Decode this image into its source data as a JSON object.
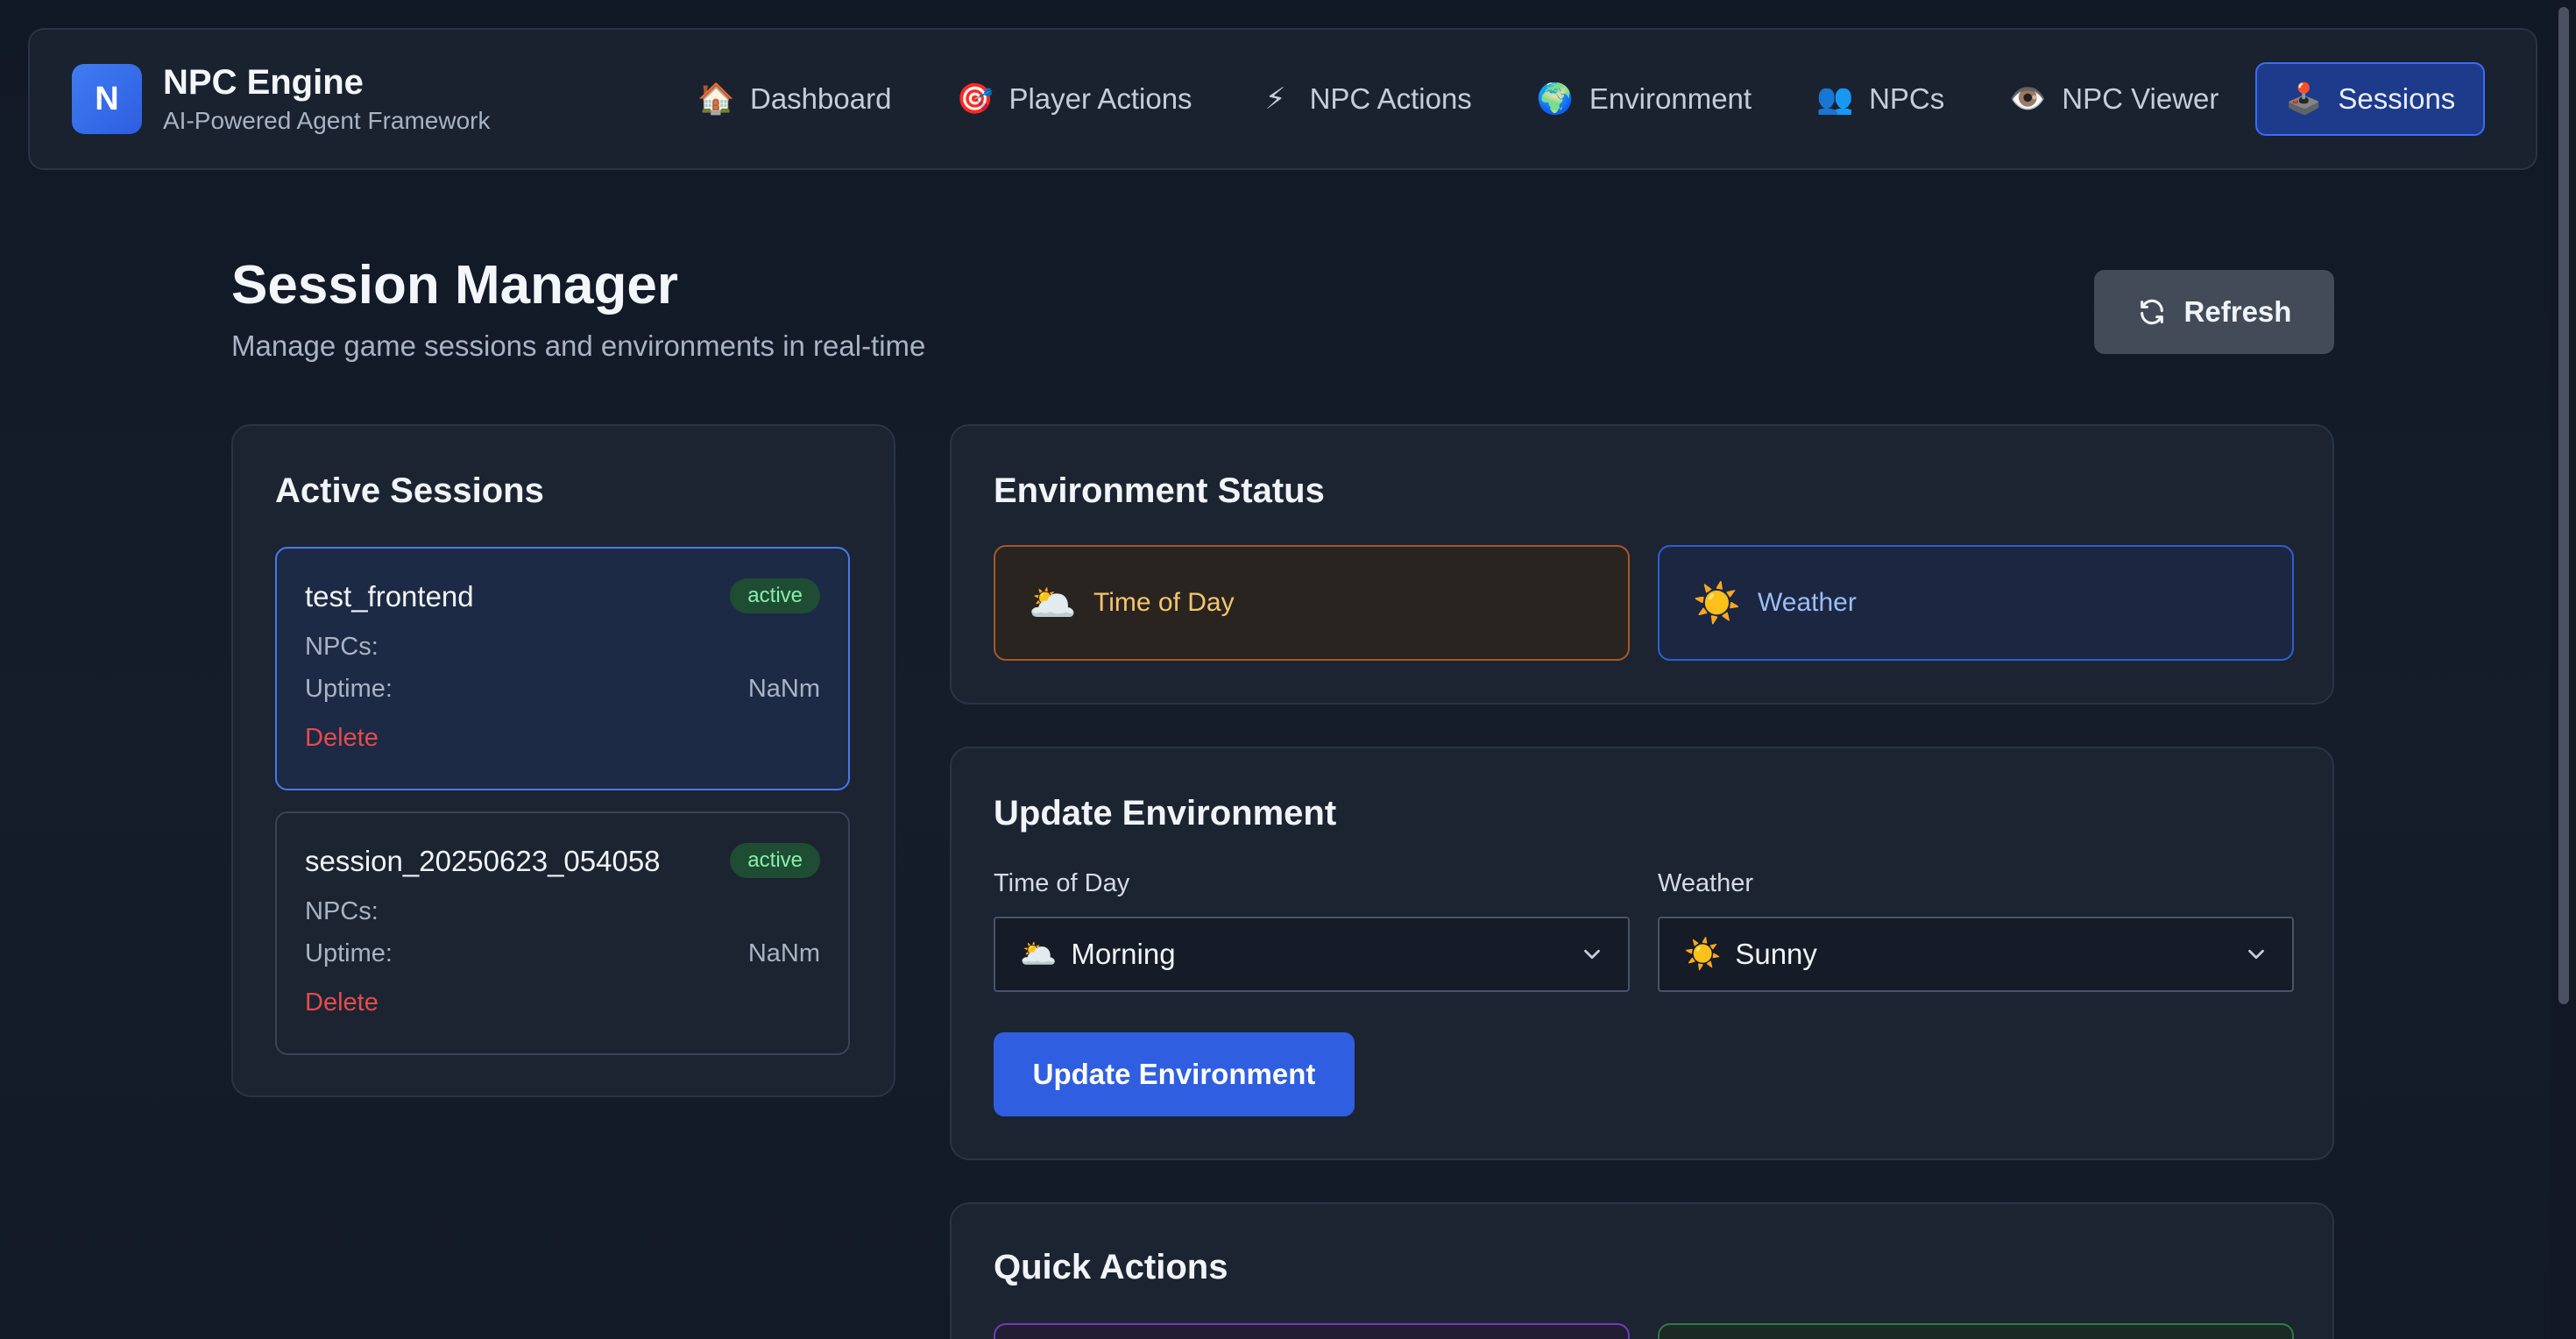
{
  "brand": {
    "logo_letter": "N",
    "title": "NPC Engine",
    "subtitle": "AI-Powered Agent Framework"
  },
  "nav": [
    {
      "icon": "🏠",
      "icon_name": "house-icon",
      "label": "Dashboard",
      "active": false
    },
    {
      "icon": "🎯",
      "icon_name": "target-icon",
      "label": "Player Actions",
      "active": false
    },
    {
      "icon": "⚡",
      "icon_name": "lightning-icon",
      "label": "NPC Actions",
      "active": false
    },
    {
      "icon": "🌍",
      "icon_name": "globe-icon",
      "label": "Environment",
      "active": false
    },
    {
      "icon": "👥",
      "icon_name": "people-icon",
      "label": "NPCs",
      "active": false
    },
    {
      "icon": "👁️",
      "icon_name": "eye-icon",
      "label": "NPC Viewer",
      "active": false
    },
    {
      "icon": "🕹️",
      "icon_name": "joystick-icon",
      "label": "Sessions",
      "active": true
    }
  ],
  "page": {
    "title": "Session Manager",
    "subtitle": "Manage game sessions and environments in real-time",
    "refresh_label": "Refresh"
  },
  "sessions": {
    "title": "Active Sessions",
    "items": [
      {
        "name": "test_frontend",
        "status": "active",
        "npcs_label": "NPCs:",
        "npcs_value": "",
        "uptime_label": "Uptime:",
        "uptime_value": "NaNm",
        "delete_label": "Delete",
        "selected": true
      },
      {
        "name": "session_20250623_054058",
        "status": "active",
        "npcs_label": "NPCs:",
        "npcs_value": "",
        "uptime_label": "Uptime:",
        "uptime_value": "NaNm",
        "delete_label": "Delete",
        "selected": false
      }
    ]
  },
  "env_status": {
    "title": "Environment Status",
    "time_of_day": {
      "icon": "🌥️",
      "label": "Time of Day"
    },
    "weather": {
      "icon": "☀️",
      "label": "Weather"
    }
  },
  "update_env": {
    "title": "Update Environment",
    "time_label": "Time of Day",
    "time_value": "Morning",
    "time_icon": "🌥️",
    "weather_label": "Weather",
    "weather_value": "Sunny",
    "weather_icon": "☀️",
    "button_label": "Update Environment"
  },
  "quick_actions": {
    "title": "Quick Actions"
  },
  "colors": {
    "accent": "#2f5ee0",
    "active_badge": "#86efac",
    "delete": "#e54b4b"
  }
}
